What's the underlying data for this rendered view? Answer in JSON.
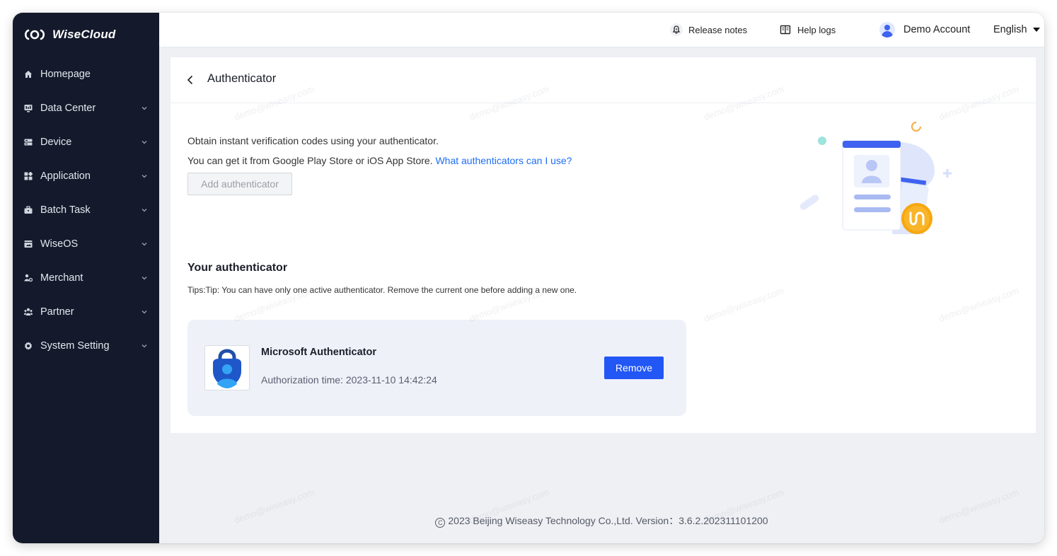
{
  "app": {
    "name": "WiseCloud"
  },
  "sidebar": {
    "items": [
      {
        "label": "Homepage",
        "icon": "home-icon",
        "expandable": false
      },
      {
        "label": "Data Center",
        "icon": "dashboard-icon",
        "expandable": true
      },
      {
        "label": "Device",
        "icon": "device-icon",
        "expandable": true
      },
      {
        "label": "Application",
        "icon": "apps-icon",
        "expandable": true
      },
      {
        "label": "Batch Task",
        "icon": "briefcase-icon",
        "expandable": true
      },
      {
        "label": "WiseOS",
        "icon": "os-icon",
        "expandable": true
      },
      {
        "label": "Merchant",
        "icon": "merchant-icon",
        "expandable": true
      },
      {
        "label": "Partner",
        "icon": "partner-icon",
        "expandable": true
      },
      {
        "label": "System Setting",
        "icon": "gear-icon",
        "expandable": true
      }
    ]
  },
  "header": {
    "release_notes": "Release notes",
    "help_logs": "Help logs",
    "account": "Demo Account",
    "language": "English"
  },
  "page": {
    "title": "Authenticator",
    "intro_line1": "Obtain instant verification codes using your authenticator.",
    "intro_line2": "You can get it from Google Play Store or iOS App Store.",
    "intro_link": "What authenticators can I use?",
    "add_button": "Add authenticator",
    "section_title": "Your authenticator",
    "tips": "Tips:Tip: You can have only one active authenticator. Remove the current one before adding a new one."
  },
  "authenticator": {
    "name": "Microsoft Authenticator",
    "auth_time": "Authorization time: 2023-11-10 14:42:24",
    "remove_button": "Remove"
  },
  "footer": {
    "text": "2023 Beijing Wiseasy Technology Co.,Ltd. Version：3.6.2.202311101200"
  },
  "watermark": "demo@wiseasy.com",
  "colors": {
    "sidebar_bg": "#141a2b",
    "primary": "#2257f5",
    "link": "#1d6ef5",
    "content_bg": "#eef0f4"
  }
}
